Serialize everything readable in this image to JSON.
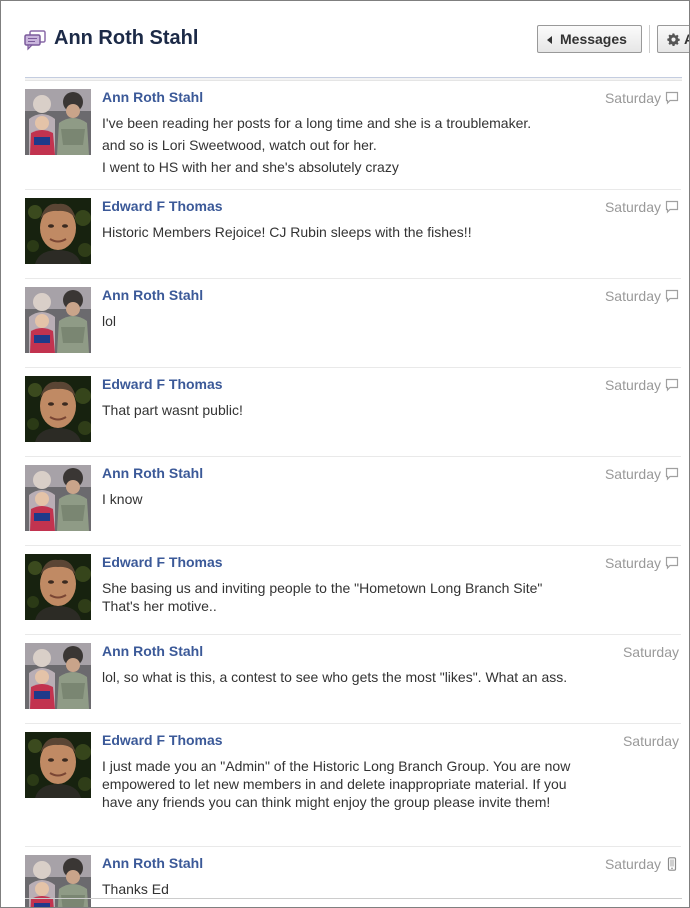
{
  "header": {
    "title": "Ann Roth Stahl",
    "messages_button": "Messages",
    "actions_button": "A"
  },
  "messages": [
    {
      "sender": "Ann Roth Stahl",
      "time": "Saturday",
      "source": "chat",
      "lines": [
        "I've been reading her posts for a long time and she is a troublemaker.",
        "and so is Lori Sweetwood, watch out for her.",
        "I went to HS with her and she's absolutely crazy"
      ]
    },
    {
      "sender": "Edward F Thomas",
      "time": "Saturday",
      "source": "chat",
      "lines": [
        "Historic Members Rejoice! CJ Rubin sleeps with the fishes!!"
      ]
    },
    {
      "sender": "Ann Roth Stahl",
      "time": "Saturday",
      "source": "chat",
      "lines": [
        "lol"
      ]
    },
    {
      "sender": "Edward F Thomas",
      "time": "Saturday",
      "source": "chat",
      "lines": [
        "That part wasnt public!"
      ]
    },
    {
      "sender": "Ann Roth Stahl",
      "time": "Saturday",
      "source": "chat",
      "lines": [
        "I know"
      ]
    },
    {
      "sender": "Edward F Thomas",
      "time": "Saturday",
      "source": "chat",
      "lines": [
        "She basing us and inviting people to the \"Hometown Long Branch Site\" That's her motive.."
      ]
    },
    {
      "sender": "Ann Roth Stahl",
      "time": "Saturday",
      "source": "",
      "lines": [
        "lol, so what is this, a contest to see who gets the most \"likes\". What an ass."
      ]
    },
    {
      "sender": "Edward F Thomas",
      "time": "Saturday",
      "source": "",
      "lines": [
        "I just made you an \"Admin\" of the Historic Long Branch Group. You are now empowered to let new members in and delete inappropriate material. If you have any friends you can think might enjoy the group please invite them!"
      ]
    },
    {
      "sender": "Ann Roth Stahl",
      "time": "Saturday",
      "source": "mobile",
      "lines": [
        "Thanks Ed"
      ]
    }
  ]
}
